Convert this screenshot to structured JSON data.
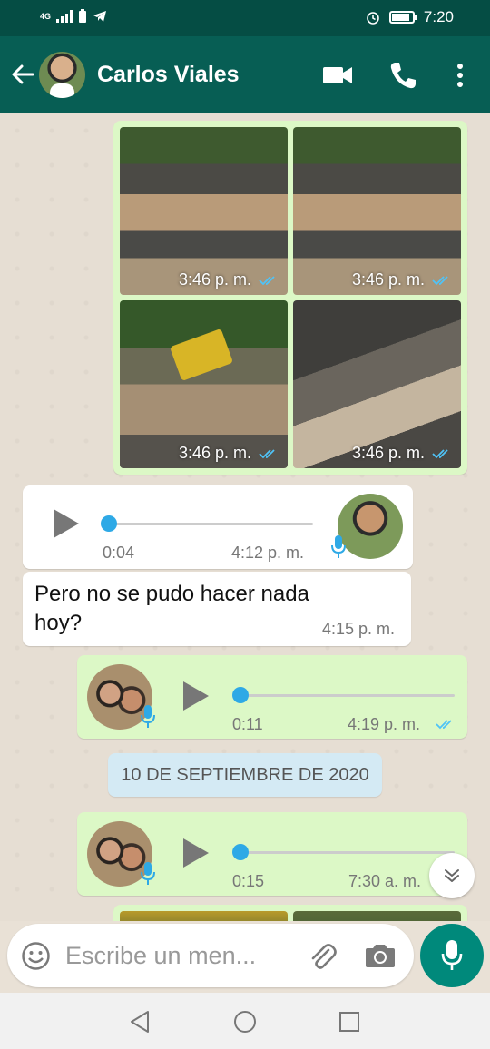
{
  "status_bar": {
    "network": "4G",
    "time": "7:20",
    "battery_level": 0.85
  },
  "header": {
    "contact_name": "Carlos Viales"
  },
  "messages": {
    "photo_grid": {
      "times": [
        "3:46 p. m.",
        "3:46 p. m.",
        "3:46 p. m.",
        "3:46 p. m."
      ]
    },
    "voice_in": {
      "duration": "0:04",
      "time": "4:12 p. m.",
      "progress": 0
    },
    "text_in": {
      "text": "Pero no se pudo hacer nada hoy?",
      "time": "4:15 p. m."
    },
    "voice_out_1": {
      "duration": "0:11",
      "time": "4:19 p. m.",
      "progress": 0
    },
    "date_separator": "10 DE SEPTIEMBRE DE 2020",
    "voice_out_2": {
      "duration": "0:15",
      "time": "7:30 a. m.",
      "progress": 0
    }
  },
  "input": {
    "placeholder": "Escribe un men..."
  },
  "colors": {
    "header": "#075e54",
    "status_bar": "#054d44",
    "outgoing": "#dcf8c6",
    "accent": "#00897b",
    "tick_blue": "#4fc3f7"
  },
  "icons": [
    "back-arrow-icon",
    "video-call-icon",
    "phone-icon",
    "more-vert-icon",
    "emoji-icon",
    "attach-icon",
    "camera-icon",
    "mic-icon",
    "chevron-down-icon"
  ]
}
